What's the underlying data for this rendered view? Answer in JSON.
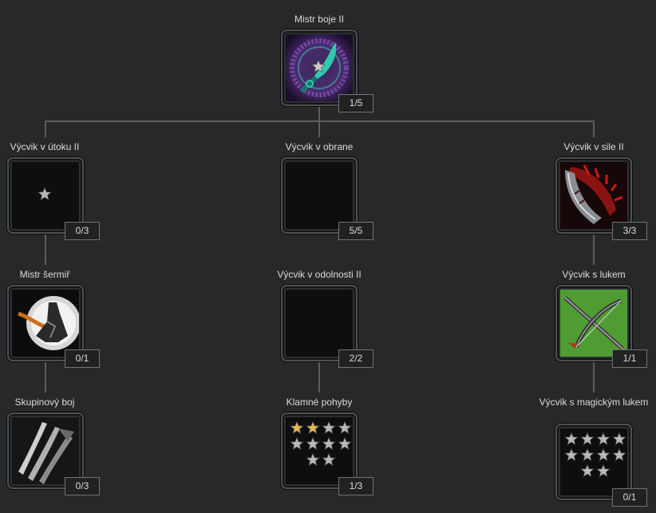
{
  "nodes": {
    "mistr_boje": {
      "label": "Mistr boje II",
      "rank": "1/5",
      "icon": "teal-rune-dagger"
    },
    "vycvik_utoku": {
      "label": "Výcvik v útoku II",
      "rank": "0/3",
      "icon": "locked-star"
    },
    "vycvik_obrane": {
      "label": "Výcvik v obrane",
      "rank": "5/5",
      "icon": "empty"
    },
    "vycvik_sile": {
      "label": "Výcvik v sile II",
      "rank": "3/3",
      "icon": "red-claw-blade"
    },
    "mistr_sermir": {
      "label": "Mistr šermiř",
      "rank": "0/1",
      "icon": "swordsman-silhouette"
    },
    "vycvik_odolnosti": {
      "label": "Výcvik v odolnosti II",
      "rank": "2/2",
      "icon": "empty"
    },
    "vycvik_lukem": {
      "label": "Výcvik s lukem",
      "rank": "1/1",
      "icon": "green-crossbow"
    },
    "skupinovy_boj": {
      "label": "Skupinový boj",
      "rank": "0/3",
      "icon": "triple-slash"
    },
    "klamne_pohyby": {
      "label": "Klamné pohyby",
      "rank": "1/3",
      "icon": "star-grid"
    },
    "vycvik_magickym": {
      "label": "Výcvik s magickým lukem",
      "rank": "0/1",
      "icon": "star-grid"
    }
  },
  "star_grids": {
    "klamne_pohyby": {
      "rows": [
        4,
        4,
        2
      ],
      "filled": 2
    },
    "vycvik_magickym": {
      "rows": [
        4,
        4,
        2
      ],
      "filled": 0
    }
  },
  "colors": {
    "background": "#272829",
    "connector": "#5b5d5f",
    "star_gold": "#e0b552",
    "star_grey": "#b8b8b8",
    "text": "#dcdcdc"
  }
}
